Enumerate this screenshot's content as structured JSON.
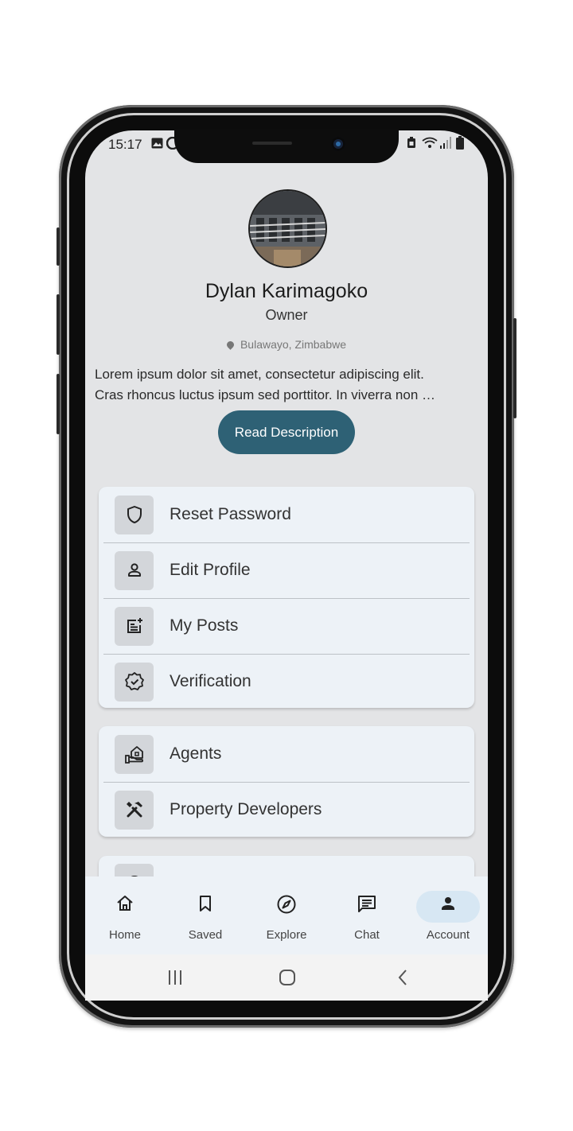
{
  "status_bar": {
    "time": "15:17",
    "left_icons": [
      "image-icon",
      "moon-icon"
    ],
    "right_icons": [
      "battery-saver-icon",
      "wifi-icon",
      "signal-icon",
      "battery-icon"
    ]
  },
  "profile": {
    "avatar": "building-balcony-photo",
    "name": "Dylan Karimagoko",
    "role": "Owner",
    "location": "Bulawayo, Zimbabwe",
    "description_line1": "Lorem ipsum dolor sit amet, consectetur adipiscing elit.",
    "description_line2": "Cras rhoncus luctus ipsum sed porttitor. In viverra non …",
    "read_button": "Read Description"
  },
  "menu_group1": [
    {
      "label": "Reset Password",
      "icon": "shield-icon"
    },
    {
      "label": "Edit Profile",
      "icon": "person-icon"
    },
    {
      "label": "My Posts",
      "icon": "post-add-icon"
    },
    {
      "label": "Verification",
      "icon": "verified-badge-icon"
    }
  ],
  "menu_group2": [
    {
      "label": "Agents",
      "icon": "hand-house-icon"
    },
    {
      "label": "Property Developers",
      "icon": "tools-icon"
    }
  ],
  "bottom_nav": [
    {
      "label": "Home",
      "icon": "home-icon",
      "active": false
    },
    {
      "label": "Saved",
      "icon": "bookmark-icon",
      "active": false
    },
    {
      "label": "Explore",
      "icon": "compass-icon",
      "active": false
    },
    {
      "label": "Chat",
      "icon": "chat-icon",
      "active": false
    },
    {
      "label": "Account",
      "icon": "account-icon",
      "active": true
    }
  ],
  "colors": {
    "accent": "#2e6175",
    "background": "#e3e4e6",
    "card": "#edf2f7",
    "active_pill": "#d7e7f3"
  }
}
